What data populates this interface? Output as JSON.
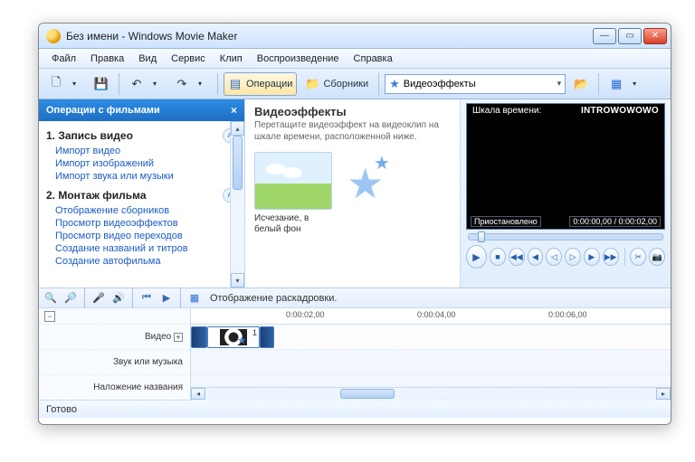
{
  "titlebar": {
    "title": "Без имени - Windows Movie Maker"
  },
  "menu": {
    "file": "Файл",
    "edit": "Правка",
    "view": "Вид",
    "tools": "Сервис",
    "clip": "Клип",
    "play": "Воспроизведение",
    "help": "Справка"
  },
  "toolbar": {
    "tasks": "Операции",
    "collections": "Сборники",
    "combo": "Видеоэффекты"
  },
  "tasks": {
    "header": "Операции с фильмами",
    "s1": {
      "title": "1. Запись видео",
      "i1": "Импорт видео",
      "i2": "Импорт изображений",
      "i3": "Импорт звука или музыки"
    },
    "s2": {
      "title": "2. Монтаж фильма",
      "i1": "Отображение сборников",
      "i2": "Просмотр видеоэффектов",
      "i3": "Просмотр видео переходов",
      "i4": "Создание названий и титров",
      "i5": "Создание автофильма"
    }
  },
  "content": {
    "title": "Видеоэффекты",
    "sub": "Перетащите видеоэффект на видеоклип на шкале времени, расположенной ниже.",
    "effect1": "Исчезание, в белый фон"
  },
  "preview": {
    "label": "Шкала времени:",
    "clip": "INTROWOWOWO",
    "state": "Приостановлено",
    "time": "0:00:00,00 / 0:00:02,00"
  },
  "tl_toolbar": {
    "label": "Отображение раскадровки."
  },
  "timeline": {
    "video": "Видео",
    "audio": "Звук или музыка",
    "title": "Наложение названия",
    "t1": "0:00:02,00",
    "t2": "0:00:04,00",
    "t3": "0:00:06,00"
  },
  "status": {
    "text": "Готово"
  }
}
